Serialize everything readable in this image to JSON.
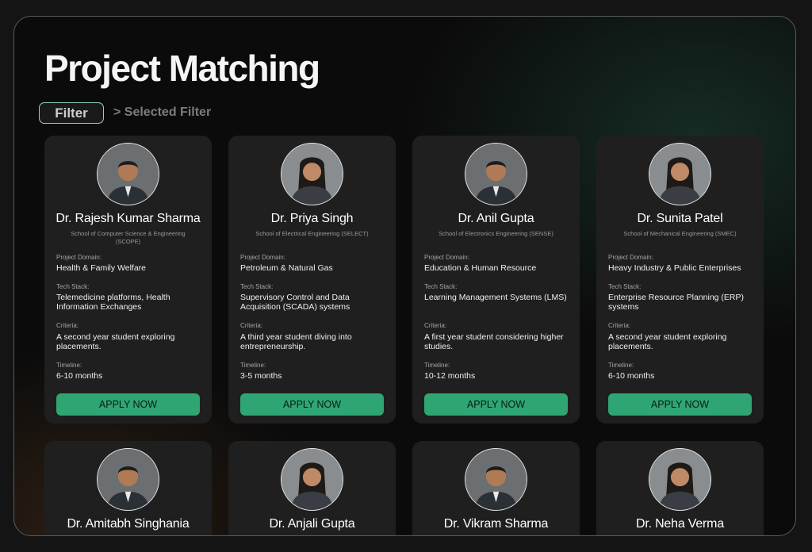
{
  "page": {
    "title": "Project Matching"
  },
  "filter": {
    "button_label": "Filter",
    "selected_label": "> Selected Filter"
  },
  "labels": {
    "domain": "Project Domain:",
    "tech": "Tech Stack:",
    "criteria": "Criteria:",
    "timeline": "Timeline:",
    "apply": "APPLY NOW"
  },
  "colors": {
    "accent": "#2fa574",
    "filter_border": "#8fd3c4",
    "card_bg": "#1f1f1f"
  },
  "cards": [
    {
      "name": "Dr. Rajesh Kumar Sharma",
      "school": "School of Computer Science & Engineering (SCOPE)",
      "domain": "Health & Family Welfare",
      "tech": "Telemedicine platforms, Health Information Exchanges",
      "criteria": "A second year student exploring placements.",
      "timeline": "6-10 months",
      "avatar_icon": "male-avatar-icon"
    },
    {
      "name": "Dr. Priya Singh",
      "school": "School of Electrical Engineering (SELECT)",
      "domain": "Petroleum & Natural Gas",
      "tech": "Supervisory Control and Data Acquisition (SCADA) systems",
      "criteria": "A third year student diving into entrepreneurship.",
      "timeline": "3-5 months",
      "avatar_icon": "female-avatar-icon"
    },
    {
      "name": "Dr. Anil Gupta",
      "school": "School of Electronics Engineering (SENSE)",
      "domain": "Education & Human Resource",
      "tech": "Learning Management Systems (LMS)",
      "criteria": "A first year student considering higher studies.",
      "timeline": "10-12 months",
      "avatar_icon": "male-avatar-icon"
    },
    {
      "name": "Dr. Sunita Patel",
      "school": "School of Mechanical Engineering (SMEC)",
      "domain": "Heavy Industry & Public Enterprises",
      "tech": "Enterprise Resource Planning (ERP) systems",
      "criteria": "A second year student exploring placements.",
      "timeline": "6-10 months",
      "avatar_icon": "female-avatar-icon"
    },
    {
      "name": "Dr. Amitabh Singhania",
      "avatar_icon": "male-avatar-icon"
    },
    {
      "name": "Dr. Anjali Gupta",
      "avatar_icon": "female-avatar-icon"
    },
    {
      "name": "Dr. Vikram Sharma",
      "avatar_icon": "male-avatar-icon"
    },
    {
      "name": "Dr. Neha Verma",
      "avatar_icon": "female-avatar-icon"
    }
  ]
}
